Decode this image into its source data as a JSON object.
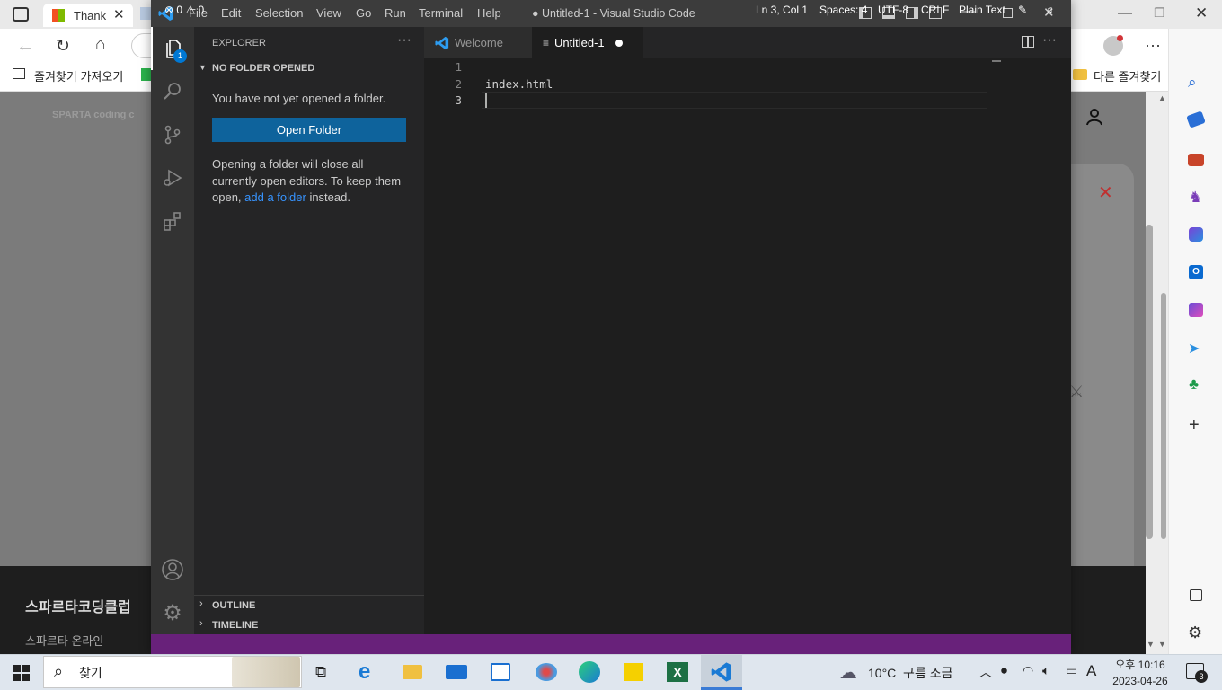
{
  "browser": {
    "tab_label": "Thank",
    "favorites_import": "즐겨찾기 가져오기",
    "other_favorites": "다른 즐겨찾기",
    "site_name": "스파르타코딩클럽",
    "site_sub": "스파르타 온라인",
    "logo_text": "SPARTA coding club"
  },
  "vscode": {
    "window_title": "● Untitled-1 - Visual Studio Code",
    "menu": [
      "File",
      "Edit",
      "Selection",
      "View",
      "Go",
      "Run",
      "Terminal",
      "Help"
    ],
    "explorer": {
      "header": "EXPLORER",
      "section": "NO FOLDER OPENED",
      "message": "You have not yet opened a folder.",
      "button": "Open Folder",
      "hint_1": "Opening a folder will close all",
      "hint_2": "currently open editors. To keep them",
      "hint_3_pre": "open, ",
      "hint_link": "add a folder",
      "hint_3_post": " instead.",
      "outline": "OUTLINE",
      "timeline": "TIMELINE"
    },
    "badge": "1",
    "tabs": [
      {
        "label": "Welcome"
      },
      {
        "label": "Untitled-1"
      }
    ],
    "lines": [
      {
        "num": "1",
        "text": ""
      },
      {
        "num": "2",
        "text": "index.html"
      },
      {
        "num": "3",
        "text": ""
      }
    ],
    "status": {
      "errors": "0",
      "warnings": "0",
      "position": "Ln 3, Col 1",
      "spaces": "Spaces: 4",
      "encoding": "UTF-8",
      "eol": "CRLF",
      "language": "Plain Text"
    }
  },
  "taskbar": {
    "search": "찾기",
    "weather": "10°C  구름 조금",
    "ime": "A",
    "ampm_time": "오후 10:16",
    "date": "2023-04-26",
    "notifications": "3"
  }
}
